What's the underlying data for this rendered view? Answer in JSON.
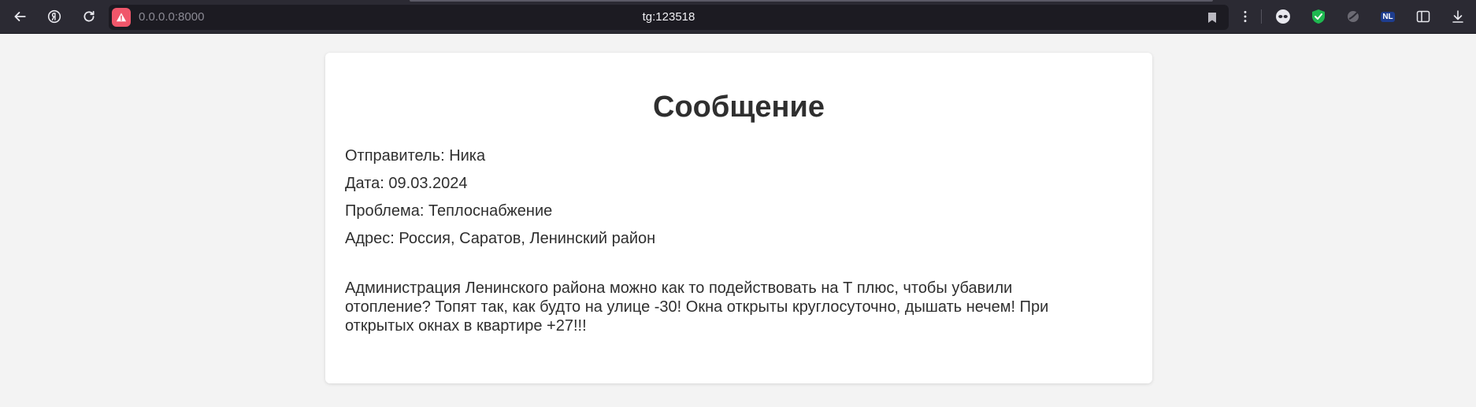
{
  "browser": {
    "url": "0.0.0.0:8000",
    "tab_title": "tg:123518",
    "icons": {
      "back": "back-arrow-icon",
      "yandex": "yandex-logo-icon",
      "reload": "reload-icon",
      "warning": "warning-icon",
      "bookmark": "bookmark-icon",
      "menu": "kebab-menu-icon",
      "extensions": [
        "mask-extension-icon",
        "shield-check-extension-icon",
        "circle-extension-icon",
        "nl-extension-icon",
        "sidebar-icon",
        "download-icon"
      ]
    },
    "colors": {
      "chrome": "#2b2a33",
      "urlbar": "#1c1b22",
      "warning": "#f0566a",
      "shield": "#1fb850"
    }
  },
  "page": {
    "title": "Сообщение",
    "sender": "Отправитель: Ника",
    "date": "Дата: 09.03.2024",
    "problem": "Проблема: Теплоснабжение",
    "address": "Адрес: Россия, Саратов, Ленинский район",
    "message": "Администрация Ленинского района можно как то подействовать на Т плюс, чтобы убавили отопление? Топят так, как будто на улице -30! Окна открыты круглосуточно, дышать нечем! При открытых окнах в квартире +27!!!"
  }
}
